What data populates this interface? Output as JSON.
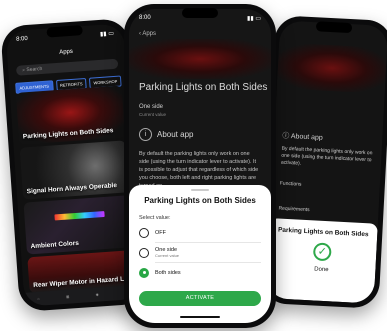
{
  "left_phone": {
    "time": "8:00",
    "title": "Apps",
    "search_placeholder": "Search",
    "chips": [
      "ADJUSTMENTS",
      "RETROFITS",
      "WORKSHOP"
    ],
    "cards": [
      {
        "label": "Parking Lights on Both Sides"
      },
      {
        "label": "Signal Horn Always Operable"
      },
      {
        "label": "Ambient Colors"
      },
      {
        "label": "Rear Wiper Motor in Hazard Light"
      }
    ]
  },
  "center_phone": {
    "time": "8:00",
    "back_label": "Apps",
    "page_title": "Parking Lights on Both Sides",
    "option_label": "One side",
    "option_sub": "Current value",
    "about_label": "About app",
    "description": "By default the parking lights only work on one side (using the turn indicator lever to activate). It is possible to adjust that regardless of which side you choose, both left and right parking lights are turned on.",
    "sheet": {
      "title": "Parking Lights on Both Sides",
      "select_label": "Select value:",
      "options": [
        {
          "label": "OFF",
          "sub": ""
        },
        {
          "label": "One side",
          "sub": "Current value"
        },
        {
          "label": "Both sides",
          "sub": ""
        }
      ],
      "selected_index": 2,
      "activate_label": "ACTIVATE"
    }
  },
  "right_phone": {
    "about_label": "About app",
    "desc": "By default the parking lights only work on one side (using the turn indicator lever to activate).",
    "functions_label": "Functions",
    "requirements_label": "Requirements",
    "sheet_title": "Parking Lights on Both Sides",
    "done_label": "Done"
  }
}
